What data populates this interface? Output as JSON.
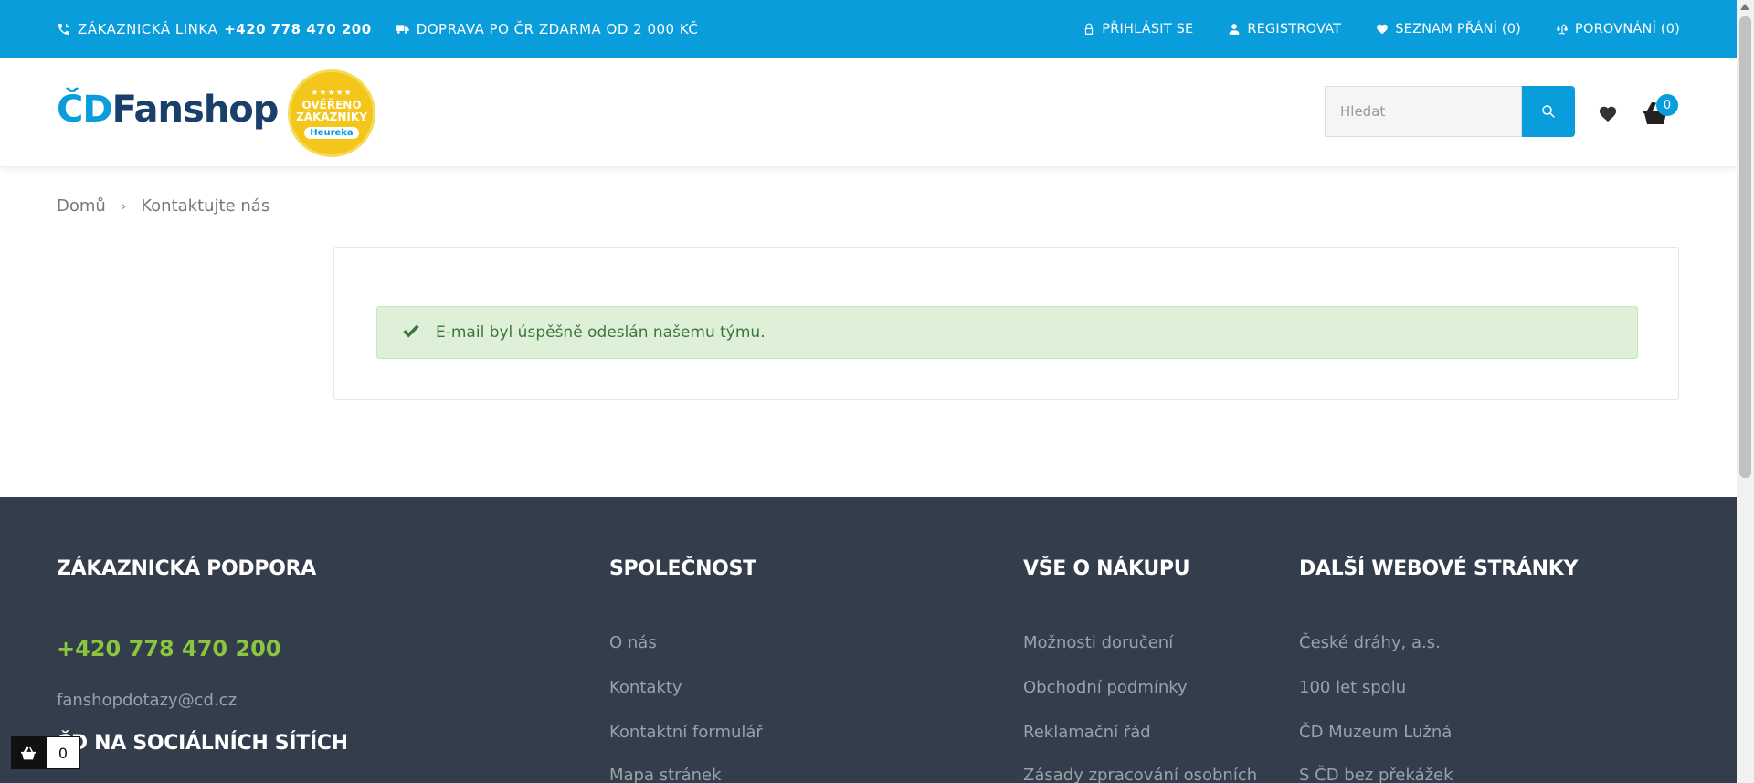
{
  "topbar": {
    "hotline_label": "Zákaznická linka",
    "hotline_number": "+420 778 470 200",
    "shipping": "Doprava po ČR zdarma od 2 000 Kč",
    "login": "Přihlásit se",
    "register": "Registrovat",
    "wishlist": "Seznam přání (0)",
    "compare": "Porovnání (0)"
  },
  "header": {
    "logo_prefix": "ČD",
    "logo_main": "Fanshop",
    "badge_line1": "OVĚŘENO",
    "badge_line2": "ZÁKAZNÍKY",
    "badge_brand": "Heureka",
    "search_placeholder": "Hledat",
    "cart_count": "0"
  },
  "breadcrumb": {
    "home": "Domů",
    "separator": "›",
    "current": "Kontaktujte nás"
  },
  "alert": {
    "message": "E-mail byl úspěšně odeslán našemu týmu."
  },
  "footer": {
    "support": {
      "title": "Zákaznická podpora",
      "phone": "+420 778 470 200",
      "email": "fanshopdotazy@cd.cz",
      "social_title": "ČD na sociálních sítích"
    },
    "company": {
      "title": "Společnost",
      "links": [
        "O nás",
        "Kontakty",
        "Kontaktní formulář",
        "Mapa stránek"
      ]
    },
    "shopping": {
      "title": "Vše o nákupu",
      "links": [
        "Možnosti doručení",
        "Obchodní podmínky",
        "Reklamační řád",
        "Zásady zpracování osobních"
      ]
    },
    "websites": {
      "title": "Další webové stránky",
      "links": [
        "České dráhy, a.s.",
        "100 let spolu",
        "ČD Muzeum Lužná",
        "S ČD bez překážek"
      ]
    }
  },
  "minicart": {
    "count": "0"
  },
  "colors": {
    "primary": "#0a9ddb",
    "brand_dark": "#1a3f6b",
    "footer_bg": "#333d4c",
    "phone_green": "#8cc63f",
    "alert_bg": "#dff0d8",
    "alert_text": "#3c763d"
  }
}
